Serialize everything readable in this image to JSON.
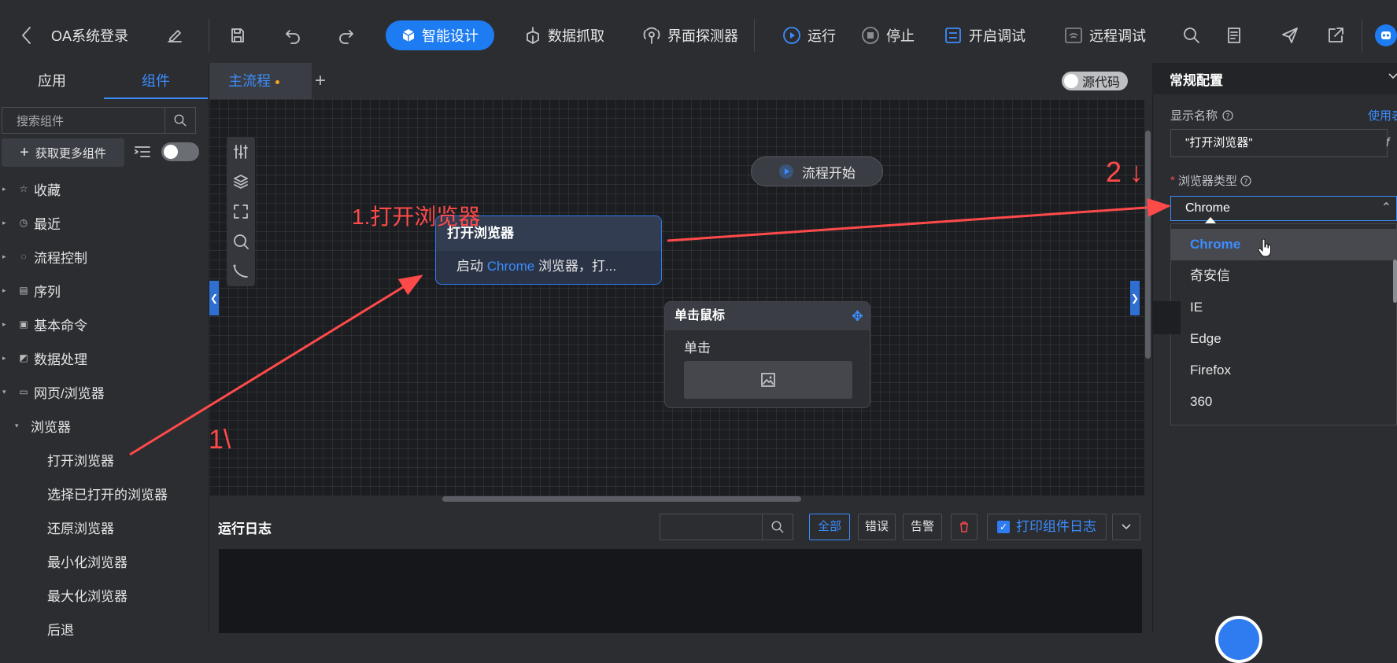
{
  "toolbar": {
    "back_icon": "chevron-left-icon",
    "title": "OA系统登录",
    "ai_design": "智能设计",
    "data_capture": "数据抓取",
    "ui_detector": "界面探测器",
    "run": "运行",
    "stop": "停止",
    "debug": "开启调试",
    "remote_debug": "远程调试"
  },
  "left_panel": {
    "tabs": [
      "应用",
      "组件"
    ],
    "search_placeholder": "搜索组件",
    "get_more": "获取更多组件",
    "tree": [
      {
        "label": "收藏",
        "icon": "star-icon"
      },
      {
        "label": "最近",
        "icon": "clock-icon"
      },
      {
        "label": "流程控制",
        "icon": "flow-icon"
      },
      {
        "label": "序列",
        "icon": "list-icon"
      },
      {
        "label": "基本命令",
        "icon": "command-icon"
      },
      {
        "label": "数据处理",
        "icon": "data-icon"
      },
      {
        "label": "网页/浏览器",
        "icon": "browser-icon"
      },
      {
        "label": "浏览器"
      },
      {
        "label": "打开浏览器"
      },
      {
        "label": "选择已打开的浏览器"
      },
      {
        "label": "还原浏览器"
      },
      {
        "label": "最小化浏览器"
      },
      {
        "label": "最大化浏览器"
      },
      {
        "label": "后退"
      }
    ]
  },
  "editor": {
    "tab_main": "主流程",
    "source_code": "源代码",
    "nodes": {
      "start": {
        "label": "流程开始"
      },
      "open_browser": {
        "title": "打开浏览器",
        "desc_prefix": "启动",
        "desc_highlight": "Chrome",
        "desc_suffix": "浏览器，打..."
      },
      "mouse_click": {
        "title": "单击鼠标",
        "body": "单击"
      }
    }
  },
  "log": {
    "title": "运行日志",
    "filters": [
      "全部",
      "错误",
      "告警"
    ],
    "print_logs": "打印组件日志"
  },
  "right_panel": {
    "section": "常规配置",
    "display_name_label": "显示名称",
    "use_expression": "使用表",
    "display_name_value": "\"打开浏览器\"",
    "fx": "f",
    "browser_type_label": "浏览器类型",
    "browser_type_value": "Chrome",
    "options": [
      "Chrome",
      "奇安信",
      "IE",
      "Edge",
      "Firefox",
      "360"
    ]
  },
  "annotations": {
    "step1_label": "1.打开浏览器",
    "mark_1": "1\\",
    "mark_2": "2 ↓",
    "color": "#ff4a4a"
  },
  "colors": {
    "accent": "#3c8dff",
    "primary_button": "#1e7cf2",
    "background": "#2b2d31",
    "canvas": "#1c1d21"
  }
}
